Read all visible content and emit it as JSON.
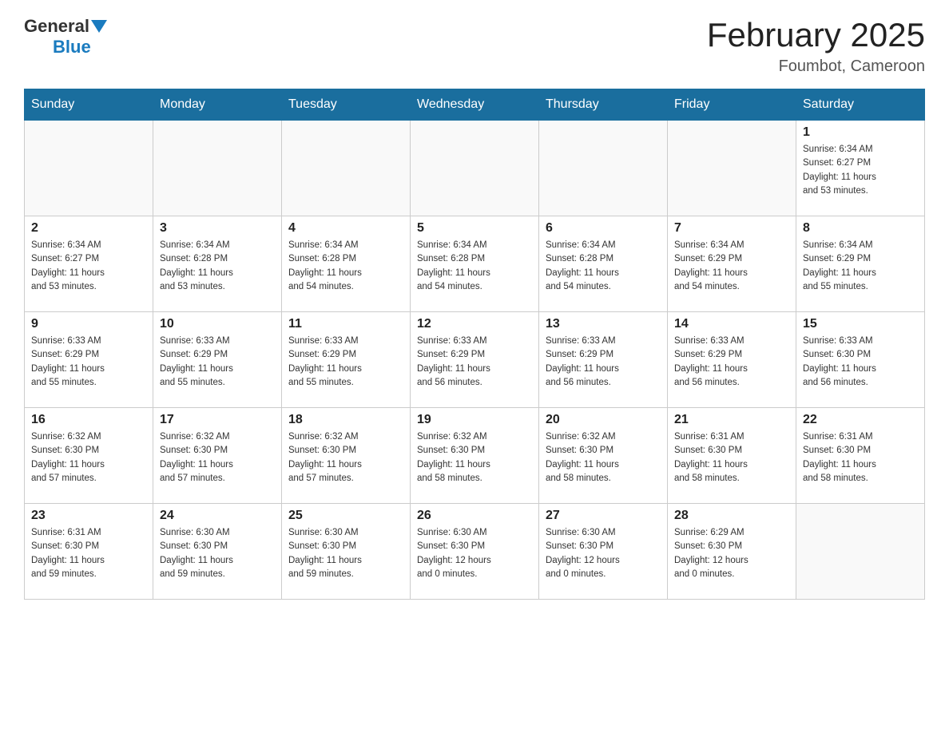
{
  "header": {
    "logo_general": "General",
    "logo_blue": "Blue",
    "month_title": "February 2025",
    "location": "Foumbot, Cameroon"
  },
  "days_of_week": [
    "Sunday",
    "Monday",
    "Tuesday",
    "Wednesday",
    "Thursday",
    "Friday",
    "Saturday"
  ],
  "weeks": [
    {
      "days": [
        {
          "date": "",
          "info": ""
        },
        {
          "date": "",
          "info": ""
        },
        {
          "date": "",
          "info": ""
        },
        {
          "date": "",
          "info": ""
        },
        {
          "date": "",
          "info": ""
        },
        {
          "date": "",
          "info": ""
        },
        {
          "date": "1",
          "info": "Sunrise: 6:34 AM\nSunset: 6:27 PM\nDaylight: 11 hours\nand 53 minutes."
        }
      ]
    },
    {
      "days": [
        {
          "date": "2",
          "info": "Sunrise: 6:34 AM\nSunset: 6:27 PM\nDaylight: 11 hours\nand 53 minutes."
        },
        {
          "date": "3",
          "info": "Sunrise: 6:34 AM\nSunset: 6:28 PM\nDaylight: 11 hours\nand 53 minutes."
        },
        {
          "date": "4",
          "info": "Sunrise: 6:34 AM\nSunset: 6:28 PM\nDaylight: 11 hours\nand 54 minutes."
        },
        {
          "date": "5",
          "info": "Sunrise: 6:34 AM\nSunset: 6:28 PM\nDaylight: 11 hours\nand 54 minutes."
        },
        {
          "date": "6",
          "info": "Sunrise: 6:34 AM\nSunset: 6:28 PM\nDaylight: 11 hours\nand 54 minutes."
        },
        {
          "date": "7",
          "info": "Sunrise: 6:34 AM\nSunset: 6:29 PM\nDaylight: 11 hours\nand 54 minutes."
        },
        {
          "date": "8",
          "info": "Sunrise: 6:34 AM\nSunset: 6:29 PM\nDaylight: 11 hours\nand 55 minutes."
        }
      ]
    },
    {
      "days": [
        {
          "date": "9",
          "info": "Sunrise: 6:33 AM\nSunset: 6:29 PM\nDaylight: 11 hours\nand 55 minutes."
        },
        {
          "date": "10",
          "info": "Sunrise: 6:33 AM\nSunset: 6:29 PM\nDaylight: 11 hours\nand 55 minutes."
        },
        {
          "date": "11",
          "info": "Sunrise: 6:33 AM\nSunset: 6:29 PM\nDaylight: 11 hours\nand 55 minutes."
        },
        {
          "date": "12",
          "info": "Sunrise: 6:33 AM\nSunset: 6:29 PM\nDaylight: 11 hours\nand 56 minutes."
        },
        {
          "date": "13",
          "info": "Sunrise: 6:33 AM\nSunset: 6:29 PM\nDaylight: 11 hours\nand 56 minutes."
        },
        {
          "date": "14",
          "info": "Sunrise: 6:33 AM\nSunset: 6:29 PM\nDaylight: 11 hours\nand 56 minutes."
        },
        {
          "date": "15",
          "info": "Sunrise: 6:33 AM\nSunset: 6:30 PM\nDaylight: 11 hours\nand 56 minutes."
        }
      ]
    },
    {
      "days": [
        {
          "date": "16",
          "info": "Sunrise: 6:32 AM\nSunset: 6:30 PM\nDaylight: 11 hours\nand 57 minutes."
        },
        {
          "date": "17",
          "info": "Sunrise: 6:32 AM\nSunset: 6:30 PM\nDaylight: 11 hours\nand 57 minutes."
        },
        {
          "date": "18",
          "info": "Sunrise: 6:32 AM\nSunset: 6:30 PM\nDaylight: 11 hours\nand 57 minutes."
        },
        {
          "date": "19",
          "info": "Sunrise: 6:32 AM\nSunset: 6:30 PM\nDaylight: 11 hours\nand 58 minutes."
        },
        {
          "date": "20",
          "info": "Sunrise: 6:32 AM\nSunset: 6:30 PM\nDaylight: 11 hours\nand 58 minutes."
        },
        {
          "date": "21",
          "info": "Sunrise: 6:31 AM\nSunset: 6:30 PM\nDaylight: 11 hours\nand 58 minutes."
        },
        {
          "date": "22",
          "info": "Sunrise: 6:31 AM\nSunset: 6:30 PM\nDaylight: 11 hours\nand 58 minutes."
        }
      ]
    },
    {
      "days": [
        {
          "date": "23",
          "info": "Sunrise: 6:31 AM\nSunset: 6:30 PM\nDaylight: 11 hours\nand 59 minutes."
        },
        {
          "date": "24",
          "info": "Sunrise: 6:30 AM\nSunset: 6:30 PM\nDaylight: 11 hours\nand 59 minutes."
        },
        {
          "date": "25",
          "info": "Sunrise: 6:30 AM\nSunset: 6:30 PM\nDaylight: 11 hours\nand 59 minutes."
        },
        {
          "date": "26",
          "info": "Sunrise: 6:30 AM\nSunset: 6:30 PM\nDaylight: 12 hours\nand 0 minutes."
        },
        {
          "date": "27",
          "info": "Sunrise: 6:30 AM\nSunset: 6:30 PM\nDaylight: 12 hours\nand 0 minutes."
        },
        {
          "date": "28",
          "info": "Sunrise: 6:29 AM\nSunset: 6:30 PM\nDaylight: 12 hours\nand 0 minutes."
        },
        {
          "date": "",
          "info": ""
        }
      ]
    }
  ]
}
